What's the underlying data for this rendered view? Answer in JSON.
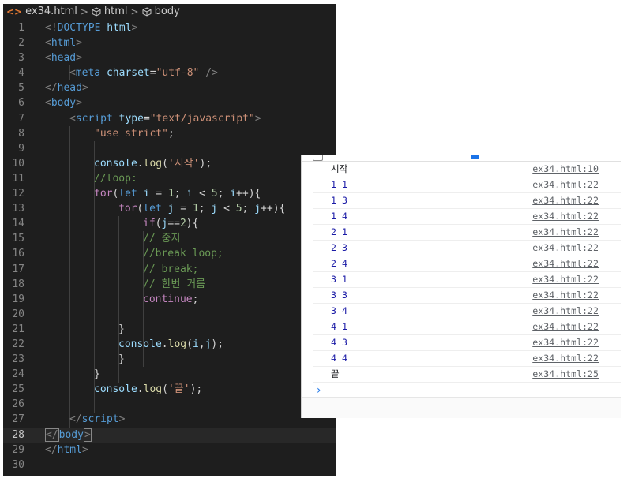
{
  "breadcrumb": {
    "file_icon": "<>",
    "file": "ex34.html",
    "sep1": ">",
    "item2": "html",
    "sep2": ">",
    "item3": "body"
  },
  "line_numbers": [
    "1",
    "2",
    "3",
    "4",
    "5",
    "6",
    "7",
    "8",
    "9",
    "10",
    "11",
    "12",
    "13",
    "14",
    "15",
    "16",
    "17",
    "18",
    "19",
    "20",
    "21",
    "22",
    "23",
    "24",
    "25",
    "26",
    "27",
    "28",
    "29",
    "30"
  ],
  "code": {
    "l1": [
      "<!",
      "DOCTYPE",
      " ",
      "html",
      ">"
    ],
    "l2": [
      "<",
      "html",
      ">"
    ],
    "l3": [
      "<",
      "head",
      ">"
    ],
    "l4": [
      "<",
      "meta",
      " ",
      "charset",
      "=",
      "\"utf-8\"",
      " />"
    ],
    "l5": [
      "</",
      "head",
      ">"
    ],
    "l6": [
      "<",
      "body",
      ">"
    ],
    "l7": [
      "<",
      "script",
      " ",
      "type",
      "=",
      "\"text/javascript\"",
      ">"
    ],
    "l8": [
      "\"use strict\"",
      ";"
    ],
    "l10": [
      "console",
      ".",
      "log",
      "(",
      "'시작'",
      ");"
    ],
    "l11": [
      "//loop:"
    ],
    "l12": [
      "for",
      "(",
      "let",
      " ",
      "i",
      " = ",
      "1",
      "; ",
      "i",
      " < ",
      "5",
      "; ",
      "i",
      "++){"
    ],
    "l13": [
      "for",
      "(",
      "let",
      " ",
      "j",
      " = ",
      "1",
      "; ",
      "j",
      " < ",
      "5",
      "; ",
      "j",
      "++){"
    ],
    "l14": [
      "if",
      "(",
      "j",
      "==",
      "2",
      "){"
    ],
    "l15": [
      "// 중지"
    ],
    "l16": [
      "//break loop;"
    ],
    "l17": [
      "// break;"
    ],
    "l18": [
      "// 한번 거름"
    ],
    "l19": [
      "continue",
      ";"
    ],
    "l21": [
      "}"
    ],
    "l22": [
      "console",
      ".",
      "log",
      "(",
      "i",
      ",",
      "j",
      ");"
    ],
    "l23": [
      "}"
    ],
    "l24": [
      "}"
    ],
    "l25": [
      "console",
      ".",
      "log",
      "(",
      "'끝'",
      ");"
    ],
    "l27": [
      "</",
      "script",
      ">"
    ],
    "l28": [
      "</",
      "body",
      ">"
    ],
    "l29": [
      "</",
      "html",
      ">"
    ]
  },
  "console": {
    "rows": [
      {
        "message": "시작",
        "source": "ex34.html:10",
        "kind": "string"
      },
      {
        "message": "1 1",
        "source": "ex34.html:22",
        "kind": "numbers"
      },
      {
        "message": "1 3",
        "source": "ex34.html:22",
        "kind": "numbers"
      },
      {
        "message": "1 4",
        "source": "ex34.html:22",
        "kind": "numbers"
      },
      {
        "message": "2 1",
        "source": "ex34.html:22",
        "kind": "numbers"
      },
      {
        "message": "2 3",
        "source": "ex34.html:22",
        "kind": "numbers"
      },
      {
        "message": "2 4",
        "source": "ex34.html:22",
        "kind": "numbers"
      },
      {
        "message": "3 1",
        "source": "ex34.html:22",
        "kind": "numbers"
      },
      {
        "message": "3 3",
        "source": "ex34.html:22",
        "kind": "numbers"
      },
      {
        "message": "3 4",
        "source": "ex34.html:22",
        "kind": "numbers"
      },
      {
        "message": "4 1",
        "source": "ex34.html:22",
        "kind": "numbers"
      },
      {
        "message": "4 3",
        "source": "ex34.html:22",
        "kind": "numbers"
      },
      {
        "message": "4 4",
        "source": "ex34.html:22",
        "kind": "numbers"
      },
      {
        "message": "끝",
        "source": "ex34.html:25",
        "kind": "string"
      }
    ],
    "prompt": "›"
  },
  "colors": {
    "editor_bg": "#1e1e1e",
    "tag": "#569cd6",
    "attribute": "#9cdcfe",
    "string": "#ce9178",
    "comment": "#6a9955",
    "keyword": "#c586c0",
    "function": "#dcdcaa",
    "number": "#b5cea8",
    "console_number": "#1a1aa6"
  },
  "icons": {
    "html_file": "html-file-icon",
    "symbol": "cube-icon",
    "prompt": "chevron-right-icon"
  }
}
